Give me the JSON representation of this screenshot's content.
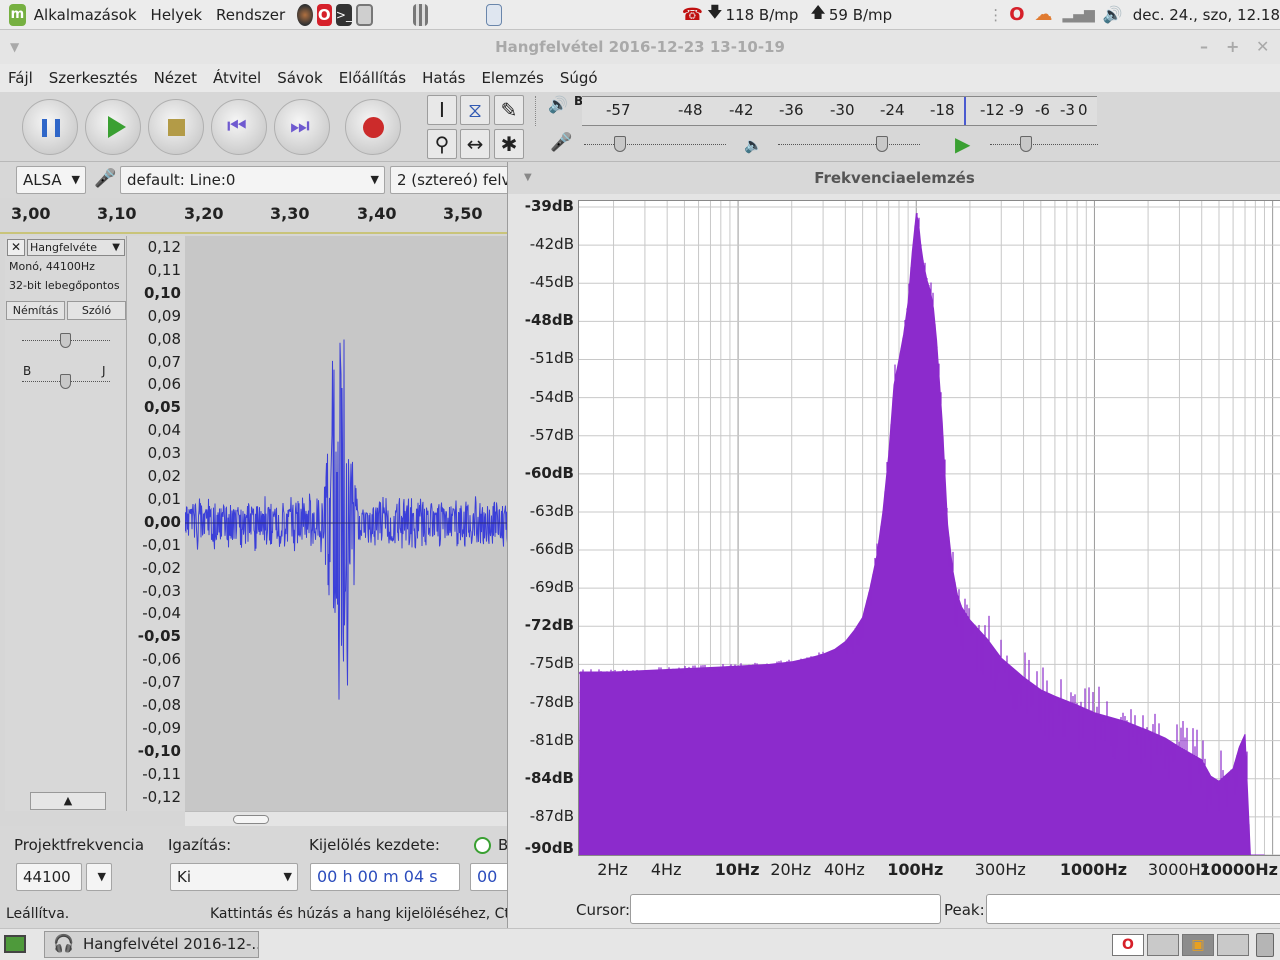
{
  "panel": {
    "menu_apps": "Alkalmazások",
    "menu_places": "Helyek",
    "menu_system": "Rendszer",
    "net_down": "118 B/mp",
    "net_up": "59 B/mp",
    "clock": "dec. 24., szo, 12.18"
  },
  "window": {
    "title": "Hangfelvétel 2016-12-23 13-10-19",
    "min": "–",
    "max": "+",
    "close": "✕"
  },
  "menu": [
    "Fájl",
    "Szerkesztés",
    "Nézet",
    "Átvitel",
    "Sávok",
    "Előállítás",
    "Hatás",
    "Elemzés",
    "Súgó"
  ],
  "meter": {
    "rec_label": "B",
    "play_label": "B",
    "ticks": [
      "-57",
      "-48",
      "-42",
      "-36",
      "-30",
      "-24",
      "-18",
      "-12",
      "-9",
      "-6",
      "-3",
      "0"
    ]
  },
  "device": {
    "host": "ALSA",
    "input": "default: Line:0",
    "channels": "2 (sztereó) felv"
  },
  "ruler": [
    "3,00",
    "3,10",
    "3,20",
    "3,30",
    "3,40",
    "3,50"
  ],
  "track": {
    "name": "Hangfelvéte",
    "info1": "Monó, 44100Hz",
    "info2": "32-bit lebegőpontos",
    "mute": "Némítás",
    "solo": "Szóló",
    "pan_l": "B",
    "pan_r": "J"
  },
  "amplitude": [
    "0,12",
    "0,11",
    "0,10",
    "0,09",
    "0,08",
    "0,07",
    "0,06",
    "0,05",
    "0,04",
    "0,03",
    "0,02",
    "0,01",
    "0,00",
    "-0,01",
    "-0,02",
    "-0,03",
    "-0,04",
    "-0,05",
    "-0,06",
    "-0,07",
    "-0,08",
    "-0,09",
    "-0,10",
    "-0,11",
    "-0,12"
  ],
  "bottom": {
    "rate_label": "Projektfrekvencia",
    "rate_value": "44100",
    "snap_label": "Igazítás:",
    "snap_value": "Ki",
    "sel_label": "Kijelölés kezdete:",
    "radio_b": "B",
    "sel_time": "00 h 00 m 04 s",
    "sel_time2": "00"
  },
  "status": {
    "left": "Leállítva.",
    "right": "Kattintás és húzás a hang kijelöléséhez, Ct"
  },
  "taskbar": {
    "task": "Hangfelvétel 2016-12-..."
  },
  "freq": {
    "title": "Frekvenciaelemzés",
    "cursor_label": "Cursor:",
    "peak_label": "Peak:",
    "cursor_value": "",
    "peak_value": ""
  },
  "chart_data": {
    "type": "area",
    "xscale": "log",
    "xlim": [
      1.28,
      11000
    ],
    "ylim": [
      -90,
      -39
    ],
    "grid": true,
    "color": "#8c2bcc",
    "ylabels": [
      "-39dB",
      "-42dB",
      "-45dB",
      "-48dB",
      "-51dB",
      "-54dB",
      "-57dB",
      "-60dB",
      "-63dB",
      "-66dB",
      "-69dB",
      "-72dB",
      "-75dB",
      "-78dB",
      "-81dB",
      "-84dB",
      "-87dB",
      "-90dB"
    ],
    "xlabels": [
      {
        "v": 2,
        "t": "2Hz",
        "b": false
      },
      {
        "v": 4,
        "t": "4Hz",
        "b": false
      },
      {
        "v": 10,
        "t": "10Hz",
        "b": true
      },
      {
        "v": 20,
        "t": "20Hz",
        "b": false
      },
      {
        "v": 40,
        "t": "40Hz",
        "b": false
      },
      {
        "v": 100,
        "t": "100Hz",
        "b": true
      },
      {
        "v": 300,
        "t": "300Hz",
        "b": false
      },
      {
        "v": 1000,
        "t": "1000Hz",
        "b": true
      },
      {
        "v": 3000,
        "t": "3000Hz",
        "b": false
      },
      {
        "v": 10000,
        "t": "10000Hz",
        "b": true
      }
    ],
    "x": [
      1.3,
      2,
      4,
      8,
      15,
      20,
      25,
      30,
      35,
      40,
      45,
      50,
      55,
      60,
      65,
      70,
      75,
      80,
      85,
      90,
      95,
      100,
      103,
      106,
      110,
      115,
      120,
      125,
      130,
      140,
      150,
      160,
      170,
      180,
      200,
      250,
      300,
      400,
      500,
      600,
      800,
      1000,
      1500,
      2000,
      2500,
      3000,
      4000,
      4500,
      5000,
      6000,
      6500,
      7000,
      7500,
      8000,
      9000
    ],
    "values": [
      -75.6,
      -75.6,
      -75.4,
      -75.2,
      -75,
      -74.8,
      -74.5,
      -74.2,
      -73.8,
      -73.2,
      -72.3,
      -71.3,
      -69,
      -66.5,
      -63,
      -58.5,
      -53,
      -51,
      -49,
      -46.5,
      -42.5,
      -39.5,
      -40.2,
      -42,
      -43.5,
      -44.8,
      -45.6,
      -47,
      -49.5,
      -56,
      -64,
      -67.5,
      -69.5,
      -70.5,
      -71.5,
      -73,
      -74.5,
      -76,
      -77,
      -77.5,
      -78.2,
      -78.8,
      -79.5,
      -80.2,
      -80.8,
      -81.5,
      -82.5,
      -83.8,
      -84.2,
      -83.2,
      -81.5,
      -80.5,
      -90,
      -90,
      -90
    ]
  }
}
